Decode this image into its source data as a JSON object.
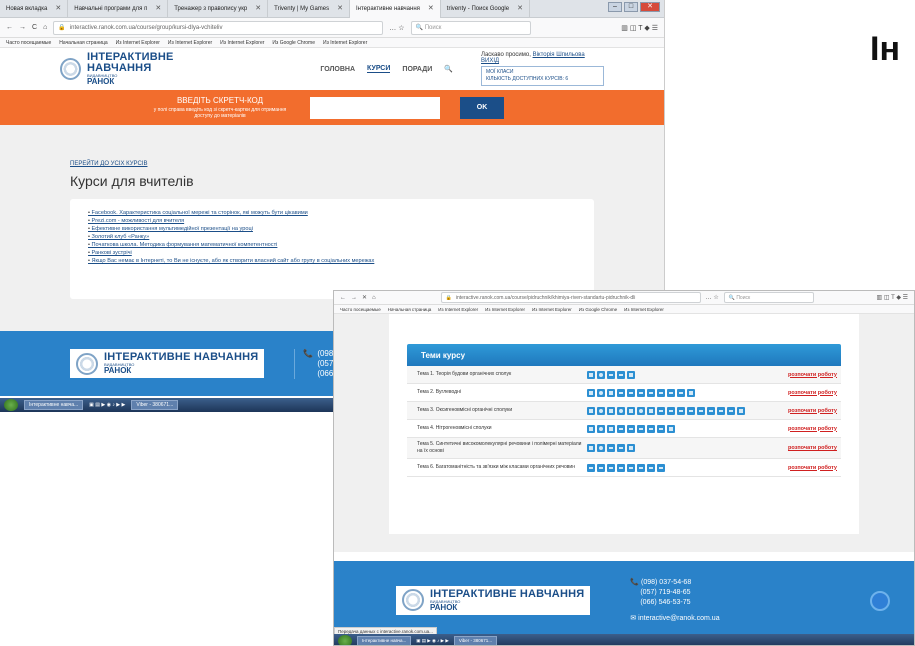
{
  "big_title": "Ін",
  "shot1": {
    "tabs": [
      {
        "label": "Новая вкладка",
        "active": false
      },
      {
        "label": "Навчальні програми для п",
        "active": false
      },
      {
        "label": "Тренажер з правопису укр",
        "active": false
      },
      {
        "label": "Triventy | My Games",
        "active": false
      },
      {
        "label": "Інтерактивне навчання",
        "active": true
      },
      {
        "label": "triventy - Поиск Google",
        "active": false
      }
    ],
    "url": "interactive.ranok.com.ua/course/group/kursi-dlya-vchiteliv",
    "search_placeholder": "Поиск",
    "bookmarks": [
      "Часто посещаемые",
      "Начальная страница",
      "Из Internet Explorer",
      "Из Internet Explorer",
      "Из Internet Explorer",
      "Из Google Chrome",
      "Из Internet Explorer"
    ],
    "logo": {
      "title": "ІНТЕРАКТИВНЕ НАВЧАННЯ",
      "sub": "ВИДАВНИЦТВО",
      "brand": "РАНОК"
    },
    "nav": [
      "ГОЛОВНА",
      "КУРСИ",
      "ПОРАДИ"
    ],
    "user": {
      "greeting": "Ласкаво просимо,",
      "name": "Вікторія Шпильова",
      "exit": "ВИХІД",
      "my_classes": "МОЇ КЛАСИ",
      "courses_count": "КІЛЬКІСТЬ ДОСТУПНИХ КУРСІВ: 6"
    },
    "scratch": {
      "title": "ВВЕДІТЬ СКРЕТЧ-КОД",
      "hint": "у полі справа введіть код зі скретч-картки для отримання доступу до матеріалів",
      "ok": "OK"
    },
    "back_link": "ПЕРЕЙТИ ДО УСІХ КУРСІВ",
    "heading": "Курси для вчителів",
    "courses": [
      "Facebook. Характеристика соціальної мережі та сторінок, які можуть бути цікавими",
      "Prezi.com - можливості для вчителя",
      "Ефективне використання мультимедійної презентації на уроці",
      "Золотий клуб «Ранку»",
      "Початкова школа. Методика формування математичної компетентності",
      "Ранкові зустрічі",
      "Якщо Вас немає в Інтернеті, то Ви не існуєте, або як створити власний сайт або групу в соціальних мережах"
    ],
    "phones": [
      "(098) 037-",
      "(057) 719-",
      "(066) 546-"
    ],
    "taskbar": [
      "Інтерактивне навча...",
      "Viber - 380671..."
    ]
  },
  "shot2": {
    "url": "interactive.ranok.com.ua/course/pidruchnik/khimiya-riven-standartu-pidruchnik-dli",
    "search_placeholder": "Поиск",
    "bookmarks": [
      "Часто посещаемые",
      "Начальная страница",
      "Из Internet Explorer",
      "Из Internet Explorer",
      "Из Internet Explorer",
      "Из Google Chrome",
      "Из Internet Explorer"
    ],
    "panel_title": "Теми курсу",
    "start_label": "розпочати роботу",
    "topics": [
      {
        "name": "Тема 1. Теорія будови органічних сполук",
        "icons": [
          "t1",
          "t2",
          "t3",
          "t3",
          "t1"
        ]
      },
      {
        "name": "Тема 2. Вуглеводні",
        "icons": [
          "t1",
          "t2",
          "t1",
          "t3",
          "t3",
          "t3",
          "t3",
          "t3",
          "t3",
          "t3",
          "t1"
        ]
      },
      {
        "name": "Тема 3. Оксигеновмісні органічні сполуки",
        "icons": [
          "t1",
          "t2",
          "t1",
          "t2",
          "t1",
          "t2",
          "t1",
          "t3",
          "t3",
          "t3",
          "t3",
          "t3",
          "t3",
          "t3",
          "t3",
          "t1"
        ]
      },
      {
        "name": "Тема 4. Нітрогеновмісні сполуки",
        "icons": [
          "t1",
          "t2",
          "t1",
          "t3",
          "t3",
          "t3",
          "t3",
          "t3",
          "t1"
        ]
      },
      {
        "name": "Тема 5. Синтетичні високомолекулярні речовини і полімерні матеріали на їх основі",
        "icons": [
          "t1",
          "t2",
          "t3",
          "t3",
          "t1"
        ]
      },
      {
        "name": "Тема 6. Багатоманітність та зв'язки між класами органічних речовин",
        "icons": [
          "t3",
          "t3",
          "t3",
          "t3",
          "t3",
          "t3",
          "t3",
          "t3"
        ]
      }
    ],
    "phones": [
      "(098) 037-54-68",
      "(057) 719-48-65",
      "(066) 546-53-75"
    ],
    "email": "interactive@ranok.com.ua",
    "status": "Передача данных с interactive.ranok.com.ua...",
    "taskbar": [
      "Інтерактивне навча...",
      "Viber - 380671..."
    ]
  }
}
